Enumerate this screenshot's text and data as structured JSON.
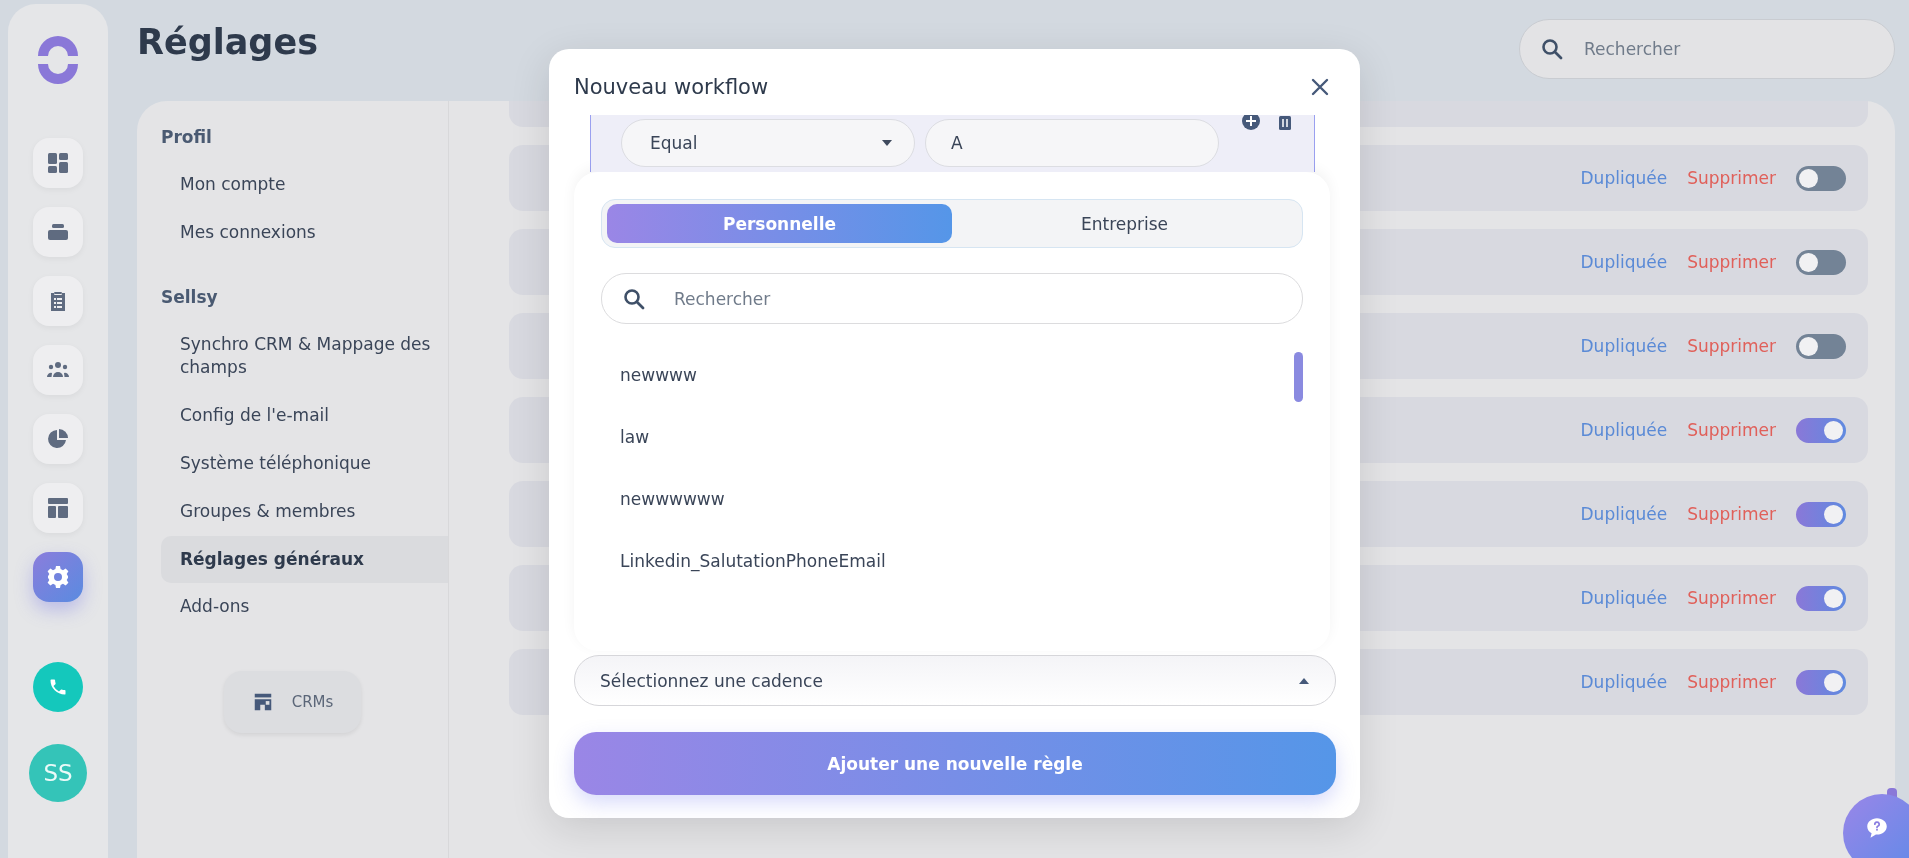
{
  "rail": {
    "items": [
      {
        "kind": "dashboard",
        "selected": false
      },
      {
        "kind": "inbox",
        "selected": false
      },
      {
        "kind": "clipboard",
        "selected": false
      },
      {
        "kind": "team",
        "selected": false
      },
      {
        "kind": "chart",
        "selected": false
      },
      {
        "kind": "layout",
        "selected": false
      },
      {
        "kind": "settings",
        "selected": true
      }
    ],
    "avatar": "SS"
  },
  "page": {
    "title": "Réglages"
  },
  "search": {
    "placeholder": "Rechercher"
  },
  "settings_menu": {
    "sections": [
      {
        "heading": "Profil",
        "items": [
          {
            "label": "Mon compte",
            "selected": false
          },
          {
            "label": "Mes connexions",
            "selected": false
          }
        ]
      },
      {
        "heading": "Sellsy",
        "items": [
          {
            "label": "Synchro CRM & Mappage des champs",
            "selected": false
          },
          {
            "label": "Config de l'e-mail",
            "selected": false
          },
          {
            "label": "Système téléphonique",
            "selected": false
          },
          {
            "label": "Groupes & membres",
            "selected": false
          },
          {
            "label": "Réglages généraux",
            "selected": true
          },
          {
            "label": "Add-ons",
            "selected": false
          }
        ]
      }
    ],
    "crm_button": "CRMs"
  },
  "workflow_rows": [
    {
      "duplicate": "Dupliquée",
      "delete": "Supprimer",
      "on": false
    },
    {
      "duplicate": "Dupliquée",
      "delete": "Supprimer",
      "on": false
    },
    {
      "duplicate": "Dupliquée",
      "delete": "Supprimer",
      "on": false
    },
    {
      "duplicate": "Dupliquée",
      "delete": "Supprimer",
      "on": true
    },
    {
      "duplicate": "Dupliquée",
      "delete": "Supprimer",
      "on": true
    },
    {
      "duplicate": "Dupliquée",
      "delete": "Supprimer",
      "on": true
    },
    {
      "duplicate": "Dupliquée",
      "delete": "Supprimer",
      "on": true
    }
  ],
  "modal": {
    "title": "Nouveau workflow",
    "condition": {
      "operator": "Equal",
      "value": "A"
    },
    "tabs": [
      {
        "label": "Personnelle",
        "selected": true
      },
      {
        "label": "Entreprise",
        "selected": false
      }
    ],
    "search": {
      "placeholder": "Rechercher"
    },
    "options": [
      "newwww",
      "law",
      "newwwwww",
      "Linkedin_SalutationPhoneEmail"
    ],
    "cadence": {
      "placeholder": "Sélectionnez une cadence"
    },
    "add_button": "Ajouter une nouvelle règle"
  }
}
